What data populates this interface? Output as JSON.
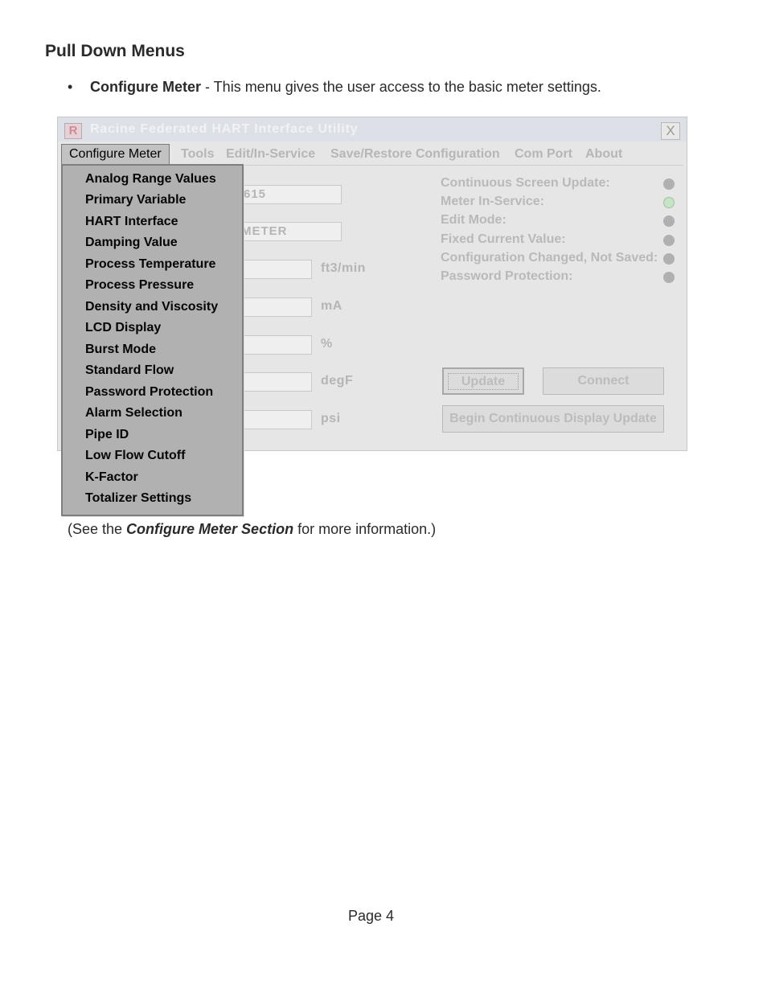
{
  "heading": "Pull Down Menus",
  "bullet": {
    "symbol": "•",
    "bold": "Configure Meter",
    "text": " - This menu gives the user access to the basic meter settings."
  },
  "window": {
    "icon_letter": "R",
    "title": "Racine Federated HART Interface Utility",
    "close_glyph": "X",
    "menu": [
      {
        "label": "Configure Meter"
      },
      {
        "label": "Tools"
      },
      {
        "label": "Edit/In-Service"
      },
      {
        "label": "Save/Restore Configuration"
      },
      {
        "label": "Com Port"
      },
      {
        "label": "About"
      }
    ],
    "fields": [
      {
        "value": "615"
      },
      {
        "value": "METER"
      },
      {
        "value": "",
        "unit": "ft3/min"
      },
      {
        "value": "",
        "unit": "mA"
      },
      {
        "value": "",
        "unit": "%"
      },
      {
        "value": "",
        "unit": "degF"
      },
      {
        "value": "",
        "unit": "psi"
      }
    ],
    "status": [
      {
        "label": "Continuous Screen Update:",
        "on": false
      },
      {
        "label": "Meter In-Service:",
        "on": true
      },
      {
        "label": "Edit Mode:",
        "on": false
      },
      {
        "label": "Fixed Current Value:",
        "on": false
      },
      {
        "label": "Configuration Changed, Not Saved:",
        "on": false
      },
      {
        "label": "Password Protection:",
        "on": false
      }
    ],
    "buttons": {
      "update": "Update",
      "connect": "Connect",
      "continuous": "Begin Continuous Display Update"
    },
    "colors": {
      "led_on": "#c4e4c4",
      "led_off": "#b0b0b0",
      "dropdown_bg": "#b1b1b1"
    }
  },
  "dropdown": [
    "Analog Range Values",
    "Primary Variable",
    "HART Interface",
    "Damping Value",
    "Process Temperature",
    "Process Pressure",
    "Density and Viscosity",
    "LCD Display",
    "Burst Mode",
    "Standard Flow",
    "Password Protection",
    "Alarm Selection",
    "Pipe ID",
    "Low Flow Cutoff",
    "K-Factor",
    "Totalizer Settings"
  ],
  "see_also": {
    "prefix": "(See the ",
    "emphasis": "Configure Meter Section",
    "suffix": " for more information.)"
  },
  "page_number": "Page 4"
}
